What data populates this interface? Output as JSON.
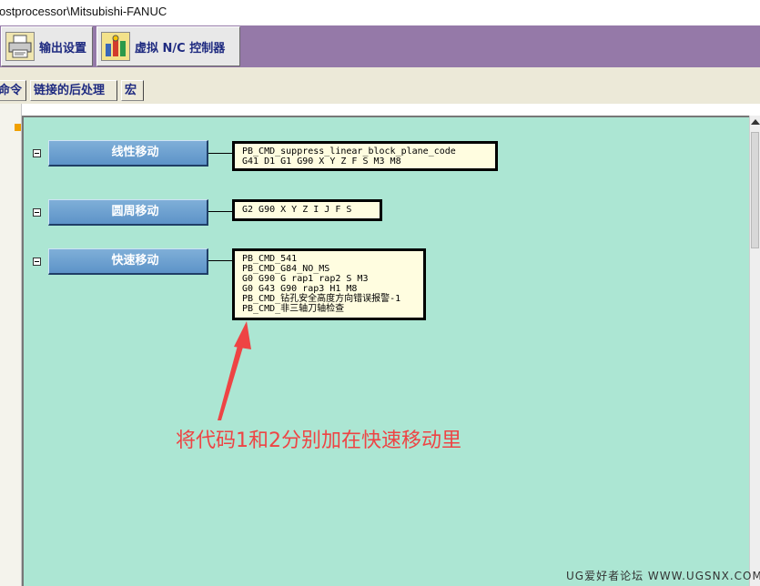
{
  "window": {
    "title": "ostprocessor\\Mitsubishi-FANUC"
  },
  "toolbar": {
    "buttons": [
      {
        "label": "输出设置",
        "icon": "printer-icon"
      },
      {
        "label": "虚拟 N/C 控制器",
        "icon": "nc-controller-icon"
      }
    ]
  },
  "subtabs": [
    "命令",
    "链接的后处理",
    "宏"
  ],
  "events": [
    {
      "label": "线性移动",
      "commands": [
        "PB_CMD_suppress_linear_block_plane_code",
        "G41 D1 G1 G90 X Y Z F S M3 M8"
      ]
    },
    {
      "label": "圆周移动",
      "commands": [
        "G2 G90 X Y Z I J F S"
      ]
    },
    {
      "label": "快速移动",
      "commands": [
        "PB_CMD_541",
        "PB_CMD_G84_NO_MS",
        "G0 G90 G rap1 rap2 S M3",
        "G0 G43 G90 rap3 H1 M8",
        "PB_CMD_钻孔安全高度方向错误报警-1",
        "PB_CMD_非三轴刀轴检查"
      ]
    }
  ],
  "annotation": {
    "text": "将代码1和2分别加在快速移动里",
    "color": "#ee4444"
  },
  "watermark": "UG爱好者论坛 WWW.UGSNX.COM",
  "colors": {
    "toolbar_bg": "#9579a8",
    "canvas_bg": "#ace6d3",
    "event_button": "#6a9fd0",
    "command_box": "#fffde0"
  }
}
